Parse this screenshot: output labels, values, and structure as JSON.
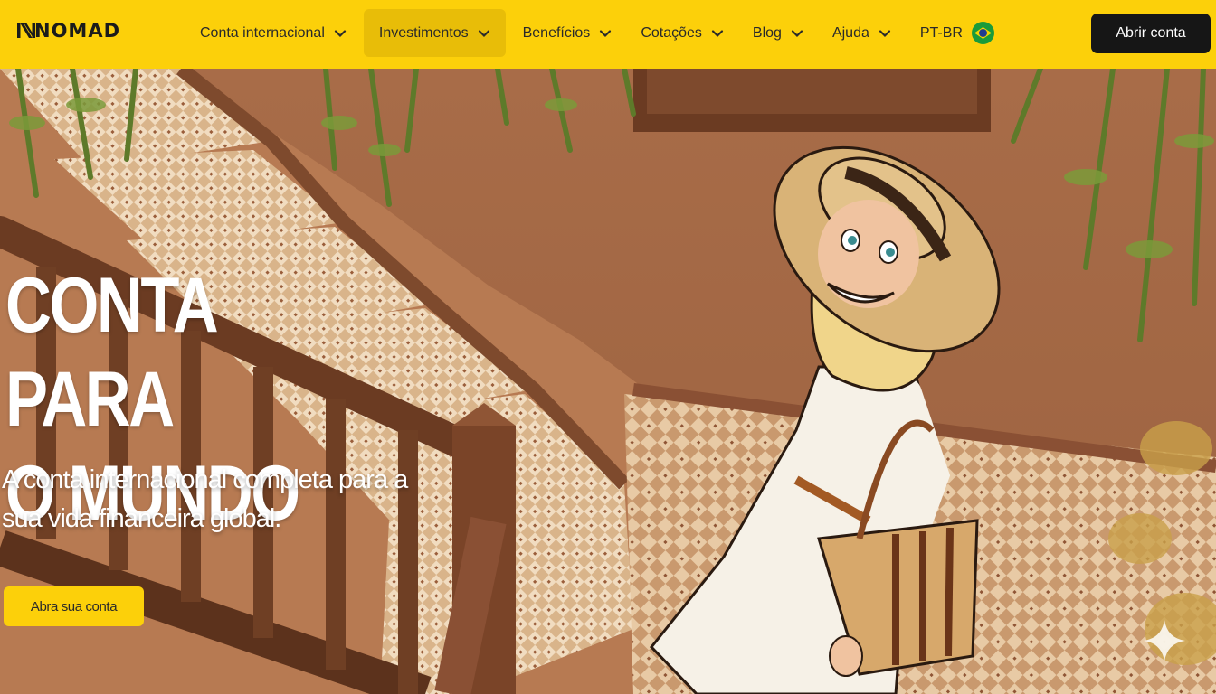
{
  "brand": {
    "logo_text": "NOMAD"
  },
  "nav": {
    "items": [
      {
        "label": "Conta internacional",
        "icon": "chevron-down-icon",
        "active": false
      },
      {
        "label": "Investimentos",
        "icon": "chevron-down-icon",
        "active": true
      },
      {
        "label": "Benefícios",
        "icon": "chevron-down-icon",
        "active": false
      },
      {
        "label": "Cotações",
        "icon": "chevron-down-icon",
        "active": false
      },
      {
        "label": "Blog",
        "icon": "chevron-down-icon",
        "active": false
      },
      {
        "label": "Ajuda",
        "icon": "chevron-down-icon",
        "active": false
      }
    ],
    "language": {
      "label": "PT-BR",
      "icon": "brazil-flag-icon"
    },
    "cta_label": "Abrir conta"
  },
  "hero": {
    "title_line1": "CONTA PARA",
    "title_line2": "O MUNDO",
    "subtitle_line1": "A conta internacional completa para a",
    "subtitle_line2": "sua vida financeira global.",
    "cta_label": "Abra sua conta",
    "illustration": "woman-in-sun-hat-on-tiled-staircase-illustration"
  },
  "colors": {
    "brand_yellow": "#fcd00a",
    "active_nav_bg": "#e8bd08",
    "dark_button": "#161616",
    "hero_wall": "#a56f4d"
  },
  "icons": {
    "sparkle": "sparkle-icon"
  }
}
